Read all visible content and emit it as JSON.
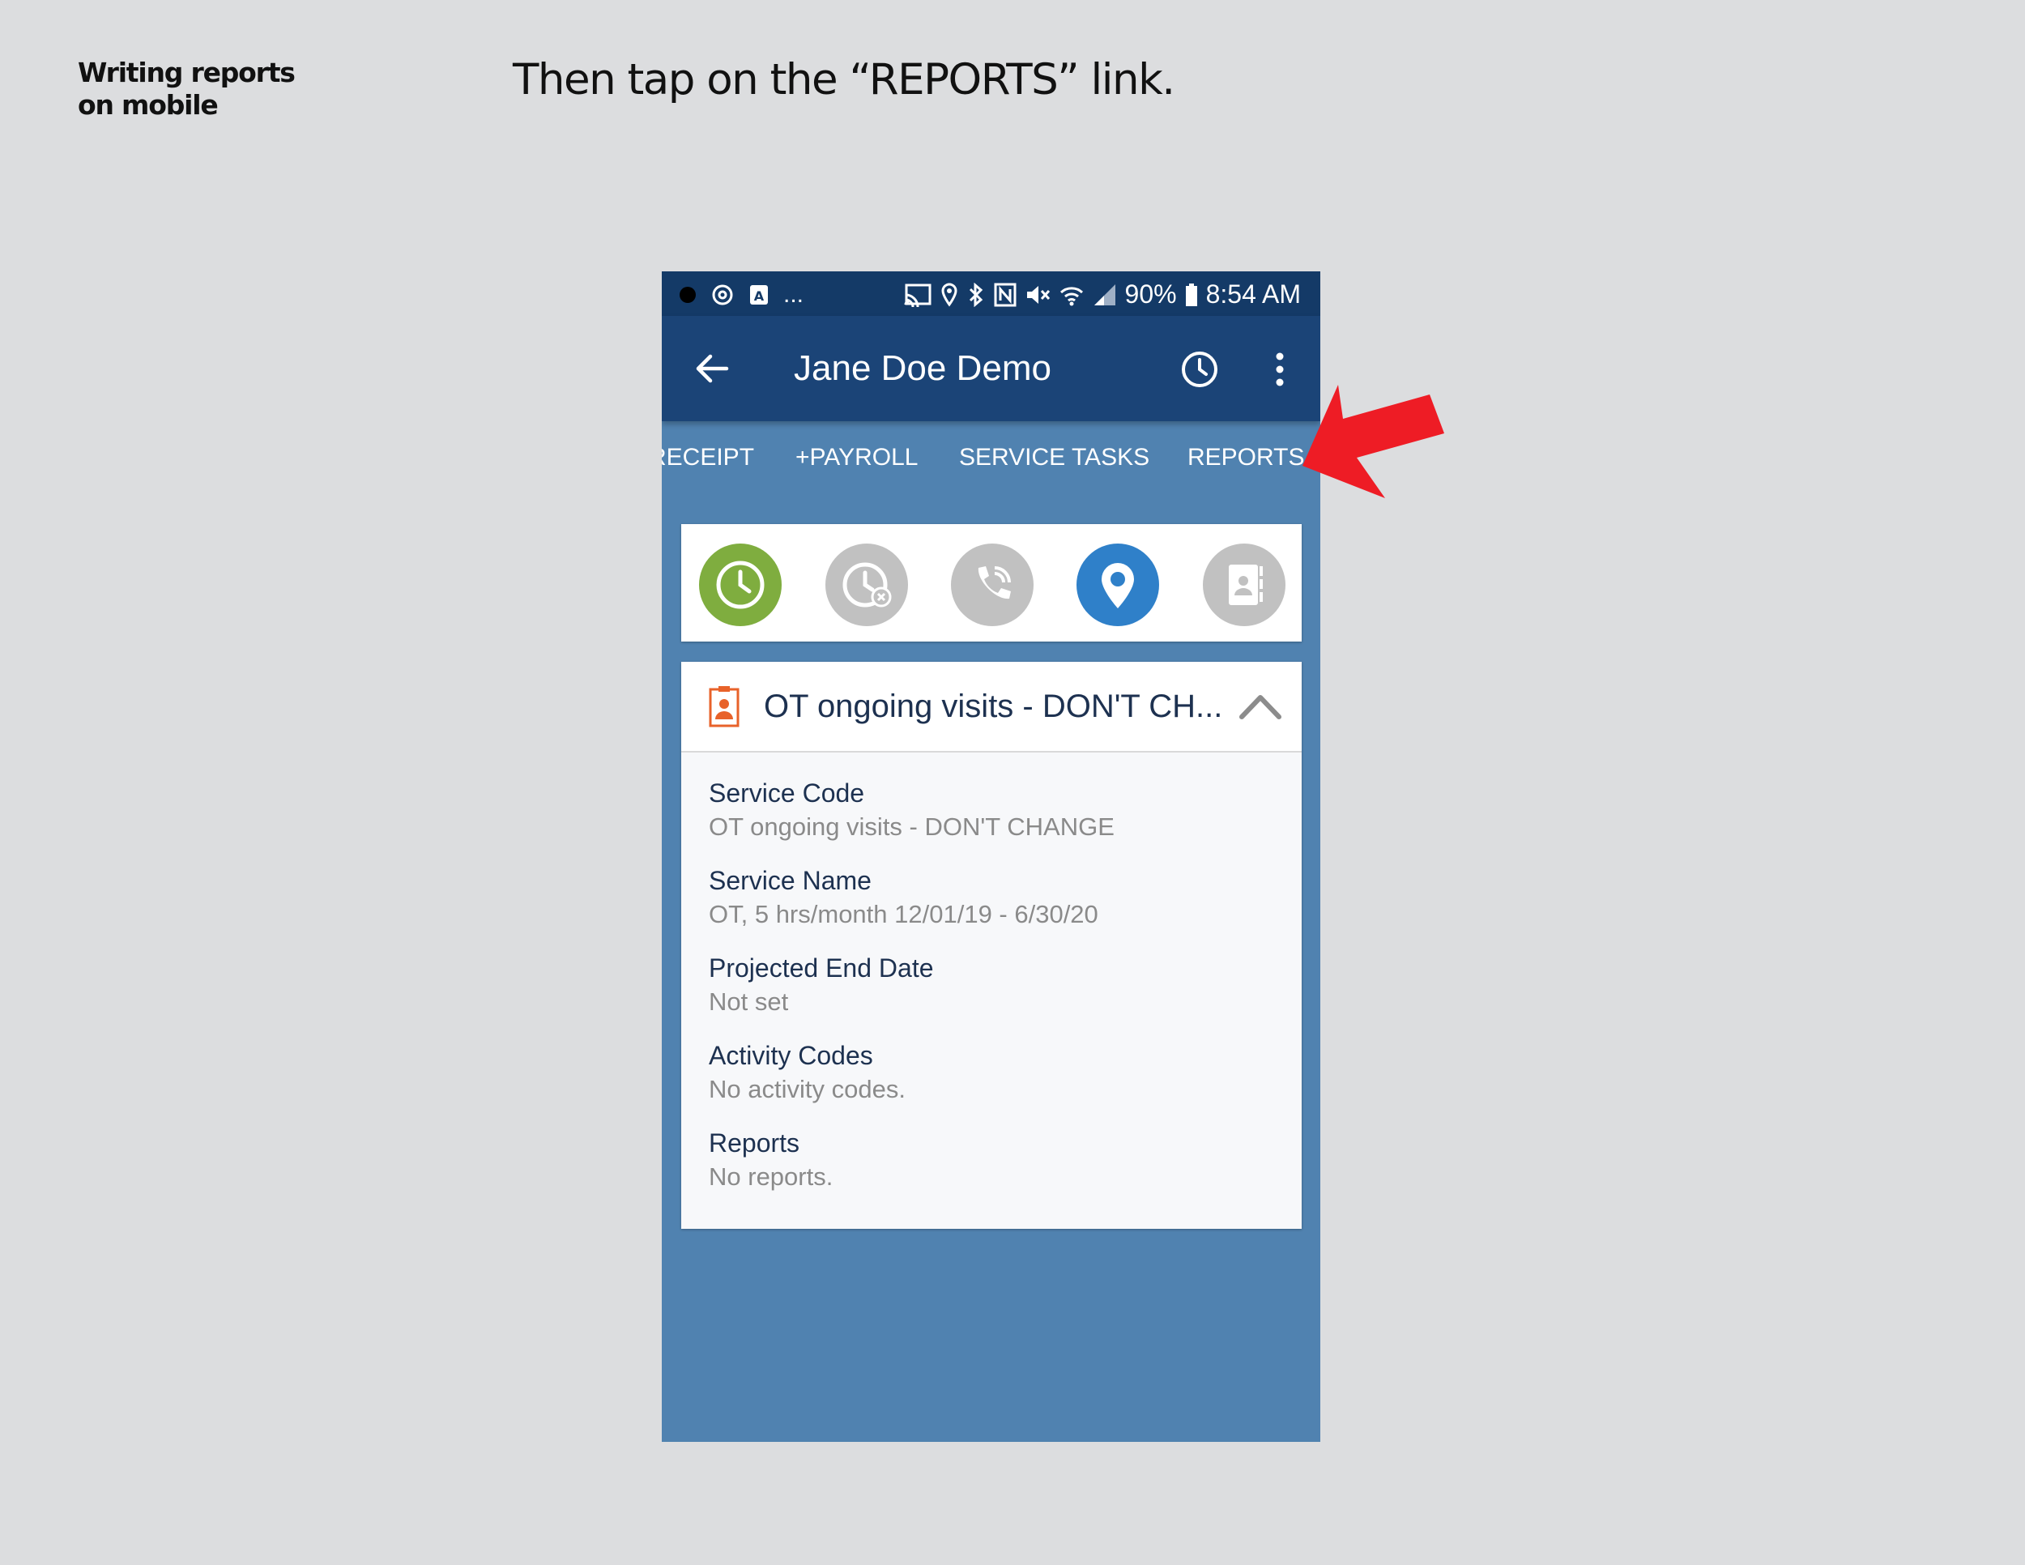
{
  "page": {
    "side_label_line1": "Writing reports",
    "side_label_line2": "on mobile",
    "instruction": "Then tap on the “REPORTS” link."
  },
  "status_bar": {
    "more": "...",
    "battery": "90%",
    "time": "8:54 AM"
  },
  "toolbar": {
    "title": "Jane Doe Demo",
    "icons": [
      "back-arrow-icon",
      "clock-icon",
      "more-vertical-icon"
    ]
  },
  "tabs": [
    {
      "label": "RECEIPT"
    },
    {
      "label": "+PAYROLL"
    },
    {
      "label": "SERVICE TASKS"
    },
    {
      "label": "REPORTS"
    }
  ],
  "quick_actions": [
    {
      "icon": "clock-in-icon",
      "color": "#7fad3f"
    },
    {
      "icon": "clock-cancel-icon",
      "color": "#c1c1c1"
    },
    {
      "icon": "phone-icon",
      "color": "#c1c1c1"
    },
    {
      "icon": "location-pin-icon",
      "color": "#2f80c9"
    },
    {
      "icon": "contact-book-icon",
      "color": "#c1c1c1"
    }
  ],
  "service": {
    "title": "OT ongoing visits - DON'T CH...",
    "fields": [
      {
        "label": "Service Code",
        "value": "OT ongoing visits - DON'T CHANGE"
      },
      {
        "label": "Service Name",
        "value": "OT, 5 hrs/month 12/01/19 - 6/30/20"
      },
      {
        "label": "Projected End Date",
        "value": "Not set"
      },
      {
        "label": "Activity Codes",
        "value": "No activity codes."
      },
      {
        "label": "Reports",
        "value": "No reports."
      }
    ]
  },
  "colors": {
    "status_bar": "#143a67",
    "toolbar": "#1b4477",
    "screen_bg": "#5082b0",
    "arrow": "#ee1c25",
    "service_icon": "#e8622a"
  }
}
